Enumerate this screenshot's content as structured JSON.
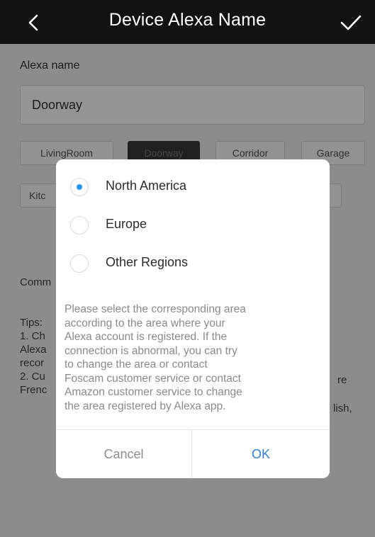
{
  "header": {
    "title": "Device Alexa Name",
    "back_icon": "chevron-left-icon",
    "confirm_icon": "checkmark-icon"
  },
  "form": {
    "alexa_name_label": "Alexa name",
    "alexa_name_value": "Doorway",
    "suggestions": [
      "LivingRoom",
      "Doorway",
      "Corridor",
      "Garage",
      "Kitc"
    ],
    "selected_suggestion": "Doorway",
    "common_label_partial": "Comm",
    "tips_visible_fragments": [
      "Tips:",
      "1. Ch",
      "Alexa",
      "recor",
      "2. Cu",
      "Frenc"
    ],
    "tips_right_fragments": [
      "re",
      "lish,"
    ]
  },
  "dialog": {
    "options": [
      {
        "label": "North America",
        "selected": true
      },
      {
        "label": "Europe",
        "selected": false
      },
      {
        "label": "Other Regions",
        "selected": false
      }
    ],
    "description_lines": [
      "Please select the corresponding area",
      "according to the area where your",
      "Alexa account is registered. If the",
      "connection is abnormal, you can try",
      "to change the area or contact",
      "Foscam customer service or contact",
      "Amazon customer service to change",
      "the area registered by Alexa app."
    ],
    "cancel_label": "Cancel",
    "ok_label": "OK"
  },
  "colors": {
    "header_bg": "#121212",
    "accent": "#2f7fd8",
    "radio_selected": "#2196f3"
  }
}
